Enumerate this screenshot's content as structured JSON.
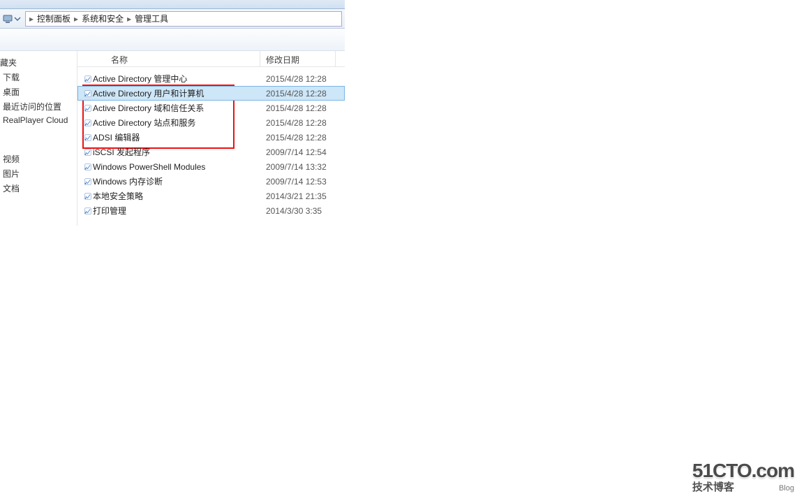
{
  "breadcrumb": {
    "items": [
      "控制面板",
      "系统和安全",
      "管理工具"
    ]
  },
  "columns": {
    "name": "名称",
    "date": "修改日期"
  },
  "sidebar": {
    "heading": "藏夹",
    "items": [
      "下载",
      "桌面",
      "最近访问的位置",
      "RealPlayer Cloud"
    ],
    "group2": [
      "视频",
      "图片",
      "文档"
    ]
  },
  "files": [
    {
      "name": "Active Directory 管理中心",
      "date": "2015/4/28 12:28",
      "selected": false
    },
    {
      "name": "Active Directory 用户和计算机",
      "date": "2015/4/28 12:28",
      "selected": true
    },
    {
      "name": "Active Directory 域和信任关系",
      "date": "2015/4/28 12:28",
      "selected": false
    },
    {
      "name": "Active Directory 站点和服务",
      "date": "2015/4/28 12:28",
      "selected": false
    },
    {
      "name": "ADSI 编辑器",
      "date": "2015/4/28 12:28",
      "selected": false
    },
    {
      "name": "iSCSI 发起程序",
      "date": "2009/7/14 12:54",
      "selected": false
    },
    {
      "name": "Windows PowerShell Modules",
      "date": "2009/7/14 13:32",
      "selected": false
    },
    {
      "name": "Windows 内存诊断",
      "date": "2009/7/14 12:53",
      "selected": false
    },
    {
      "name": "本地安全策略",
      "date": "2014/3/21 21:35",
      "selected": false
    },
    {
      "name": "打印管理",
      "date": "2014/3/30 3:35",
      "selected": false
    }
  ],
  "highlight": {
    "startIndex": 0,
    "endIndex": 3
  },
  "watermark": {
    "line1": "51CTO.com",
    "line2": "技术博客",
    "line2_sub": "Blog"
  }
}
